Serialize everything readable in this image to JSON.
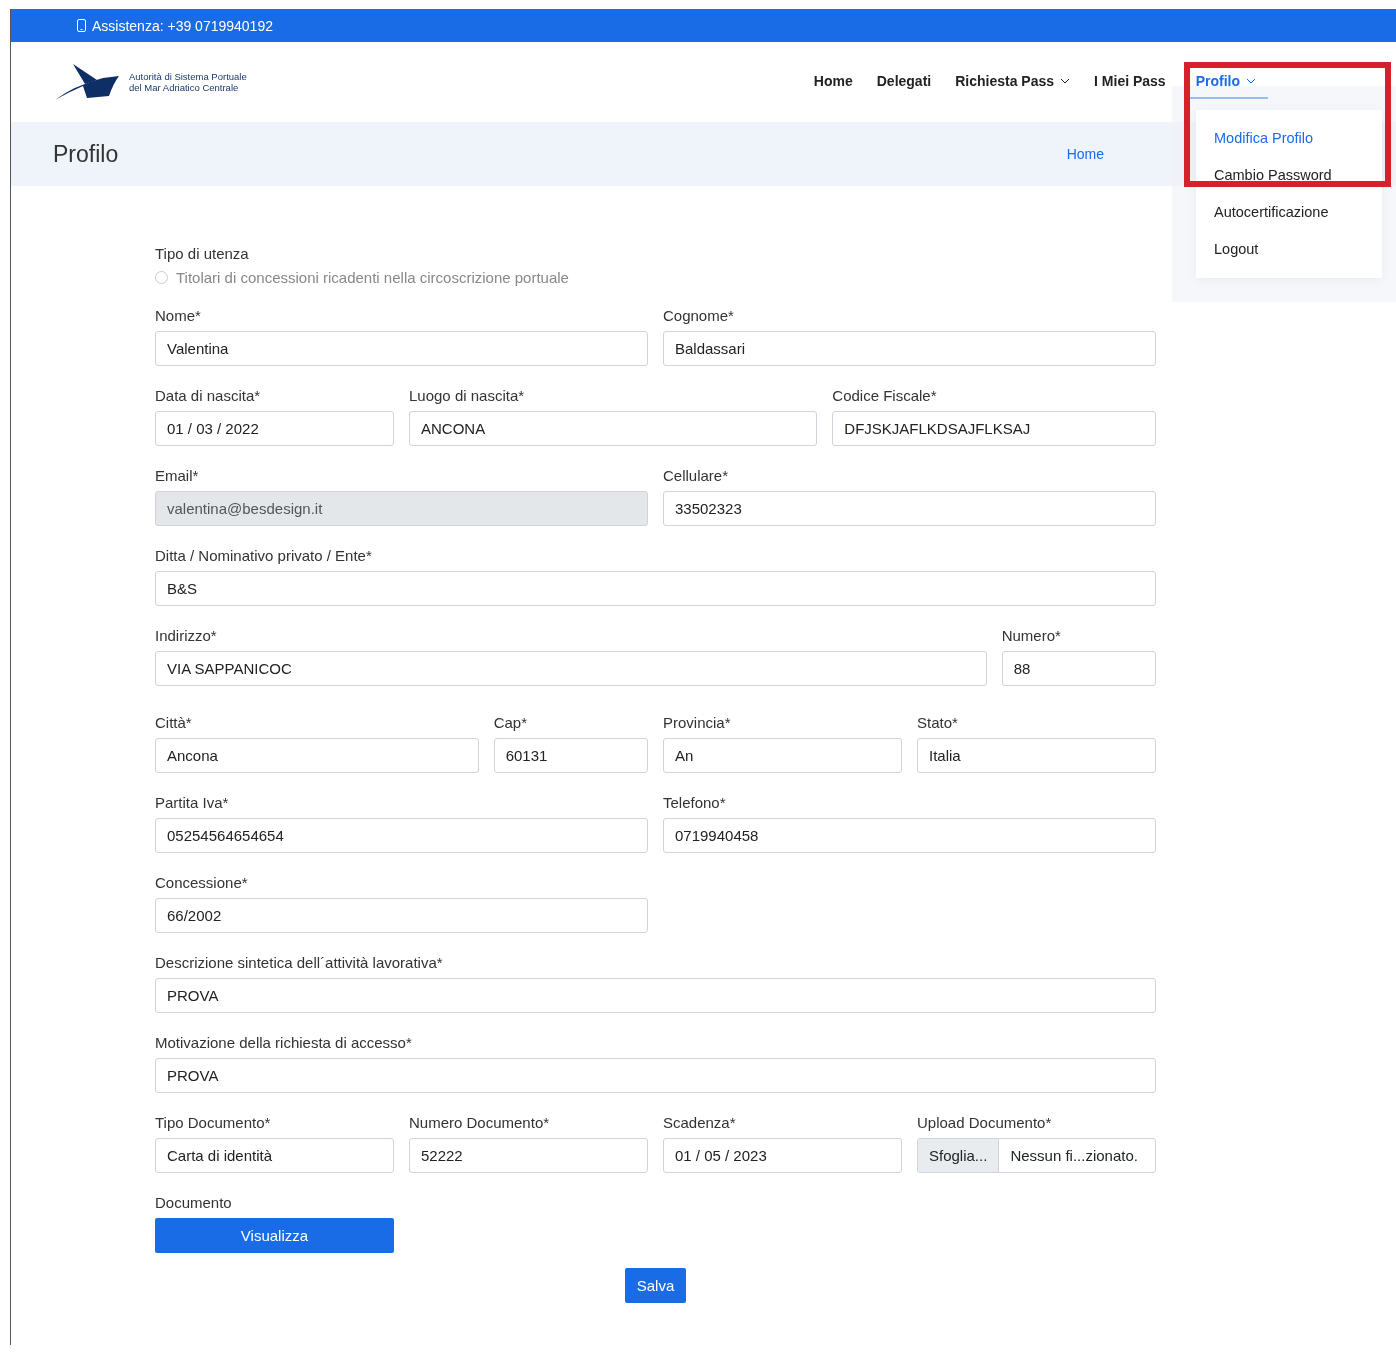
{
  "top_bar": {
    "text": "Assistenza: +39 0719940192"
  },
  "header": {
    "logo_lines": [
      "Autorità di Sistema Portuale",
      "del Mar Adriatico Centrale"
    ],
    "nav": [
      {
        "label": "Home",
        "selected": false,
        "dropdown": false
      },
      {
        "label": "Delegati",
        "selected": false,
        "dropdown": false
      },
      {
        "label": "Richiesta Pass",
        "selected": false,
        "dropdown": true
      },
      {
        "label": "I Miei Pass",
        "selected": false,
        "dropdown": false
      },
      {
        "label": "Profilo",
        "selected": true,
        "dropdown": true
      }
    ],
    "menu": [
      {
        "label": "Modifica Profilo",
        "selected": true
      },
      {
        "label": "Cambio Password",
        "selected": false
      },
      {
        "label": "Autocertificazione",
        "selected": false
      },
      {
        "label": "Logout",
        "selected": false
      }
    ]
  },
  "title_band": {
    "title": "Profilo",
    "breadcrumb": "Home"
  },
  "form": {
    "user_type": {
      "label": "Tipo di utenza",
      "option": "Titolari di concessioni ricadenti nella circoscrizione portuale",
      "checked": false,
      "disabled": true
    },
    "rows": [
      [
        {
          "label": "Nome*",
          "value": "Valentina",
          "disabled": false
        },
        {
          "label": "Cognome*",
          "value": "Baldassari",
          "disabled": false
        }
      ],
      [
        {
          "label": "Data di nascita*",
          "value": "01 / 03 / 2022",
          "disabled": false
        },
        {
          "label": "Luogo di nascita*",
          "value": "ANCONA",
          "disabled": false
        },
        {
          "label": "Codice Fiscale*",
          "value": "DFJSKJAFLKDSAJFLKSAJ",
          "disabled": false
        }
      ],
      [
        {
          "label": "Email*",
          "value": "valentina@besdesign.it",
          "disabled": true
        },
        {
          "label": "Cellulare*",
          "value": "33502323",
          "disabled": false
        }
      ],
      [
        {
          "label": "Ditta / Nominativo privato / Ente*",
          "value": "B&S",
          "disabled": false
        }
      ],
      [
        {
          "label": "Indirizzo*",
          "value": "VIA SAPPANICOC",
          "disabled": false
        },
        {
          "label": "Numero*",
          "value": "88",
          "disabled": false
        }
      ],
      [
        {
          "label": "Città*",
          "value": "Ancona",
          "disabled": false
        },
        {
          "label": "Cap*",
          "value": "60131",
          "disabled": false
        },
        {
          "label": "Provincia*",
          "value": "An",
          "disabled": false
        },
        {
          "label": "Stato*",
          "value": "Italia",
          "disabled": false
        }
      ],
      [
        {
          "label": "Partita Iva*",
          "value": "05254564654654",
          "disabled": false
        },
        {
          "label": "Telefono*",
          "value": "0719940458",
          "disabled": false
        }
      ],
      [
        {
          "label": "Concessione*",
          "value": "66/2002",
          "disabled": false
        }
      ],
      [
        {
          "label": "Descrizione sintetica dell´attività lavorativa*",
          "value": "PROVA",
          "disabled": false
        }
      ],
      [
        {
          "label": "Motivazione della richiesta di accesso*",
          "value": "PROVA",
          "disabled": false
        }
      ],
      [
        {
          "label": "Tipo Documento*",
          "value": "Carta di identità",
          "disabled": false
        },
        {
          "label": "Numero Documento*",
          "value": "52222",
          "disabled": false
        },
        {
          "label": "Scadenza*",
          "value": "01 / 05 / 2023",
          "disabled": false
        },
        {
          "label": "Upload Documento*",
          "kind": "file",
          "button": "Sfoglia...",
          "value": "Nessun fi...zionato."
        }
      ]
    ],
    "document": {
      "label": "Documento",
      "button": "Visualizza"
    },
    "save_button": "Salva"
  }
}
